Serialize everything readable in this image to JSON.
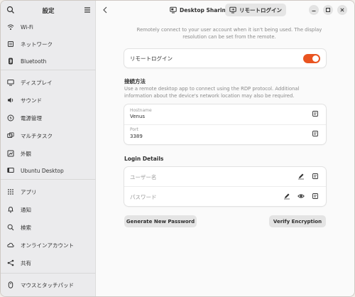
{
  "sidebar": {
    "title": "設定",
    "items": [
      {
        "label": "Wi-Fi",
        "icon": "wifi-icon"
      },
      {
        "label": "ネットワーク",
        "icon": "network-icon"
      },
      {
        "label": "Bluetooth",
        "icon": "bluetooth-icon"
      },
      {
        "label": "ディスプレイ",
        "icon": "display-icon"
      },
      {
        "label": "サウンド",
        "icon": "sound-icon"
      },
      {
        "label": "電源管理",
        "icon": "power-icon"
      },
      {
        "label": "マルチタスク",
        "icon": "multitasking-icon"
      },
      {
        "label": "外観",
        "icon": "appearance-icon"
      },
      {
        "label": "Ubuntu Desktop",
        "icon": "ubuntu-desktop-icon"
      },
      {
        "label": "アプリ",
        "icon": "apps-icon"
      },
      {
        "label": "通知",
        "icon": "bell-icon"
      },
      {
        "label": "検索",
        "icon": "search-icon"
      },
      {
        "label": "オンラインアカウント",
        "icon": "cloud-icon"
      },
      {
        "label": "共有",
        "icon": "share-icon"
      },
      {
        "label": "マウスとタッチパッド",
        "icon": "mouse-icon"
      }
    ]
  },
  "header": {
    "tabs": [
      {
        "label": "Desktop Sharing",
        "icon": "desktop-sharing-icon"
      },
      {
        "label": "リモートログイン",
        "icon": "remote-login-icon"
      }
    ]
  },
  "main": {
    "intro": "Remotely connect to your user account when it isn't being used. The display resolution can be set from the remote.",
    "remote_login_label": "リモートログイン",
    "remote_login_enabled": true,
    "accent_color": "#e95420",
    "connection": {
      "title": "接続方法",
      "description": "Use a remote desktop app to connect using the RDP protocol. Additional information about the device's network location may also be required.",
      "hostname_label": "Hostname",
      "hostname_value": "Venus",
      "port_label": "Port",
      "port_value": "3389"
    },
    "login": {
      "title": "Login Details",
      "username_placeholder": "ユーザー名",
      "password_placeholder": "パスワード"
    },
    "buttons": {
      "generate": "Generate New Password",
      "verify": "Verify Encryption"
    }
  }
}
